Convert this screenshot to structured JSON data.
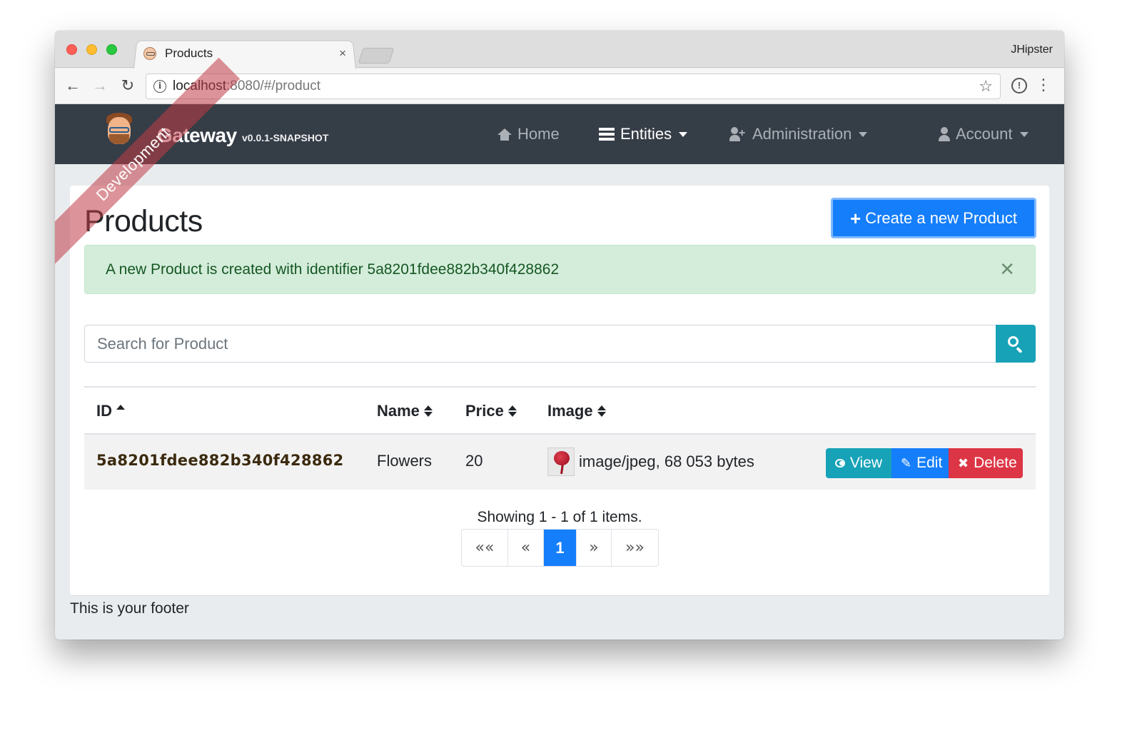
{
  "browser": {
    "tab_title": "Products",
    "tab_close": "×",
    "profile_name": "JHipster",
    "url_host": "localhost",
    "url_rest": ":8080/#/product",
    "back": "←",
    "forward": "→",
    "reload": "↻",
    "star": "☆",
    "ext": "!",
    "menu": "⋮",
    "info": "i"
  },
  "navbar": {
    "brand": "Gateway",
    "version": "v0.0.1-SNAPSHOT",
    "ribbon": "Development",
    "items": [
      {
        "label": "Home",
        "icon": "home-icon",
        "has_caret": false,
        "active": false
      },
      {
        "label": "Entities",
        "icon": "list-icon",
        "has_caret": true,
        "active": true
      },
      {
        "label": "Administration",
        "icon": "user-plus-icon",
        "has_caret": true,
        "active": false
      },
      {
        "label": "Account",
        "icon": "user-icon",
        "has_caret": true,
        "active": false
      }
    ]
  },
  "page": {
    "title": "Products",
    "create_button": "Create a new Product",
    "create_icon": "+",
    "alert": {
      "message": "A new Product is created with identifier 5a8201fdee882b340f428862",
      "close": "✕"
    },
    "search": {
      "placeholder": "Search for Product"
    }
  },
  "table": {
    "columns": [
      "ID",
      "Name",
      "Price",
      "Image"
    ],
    "rows": [
      {
        "id": "5a8201fdee882b340f428862",
        "name": "Flowers",
        "price": "20",
        "image": "image/jpeg, 68 053 bytes",
        "actions": {
          "view": "View",
          "edit": "Edit",
          "delete": "Delete",
          "edit_icon": "✎",
          "delete_icon": "✖"
        }
      }
    ]
  },
  "pagination": {
    "summary": "Showing 1 - 1 of 1 items.",
    "first": "««",
    "prev": "«",
    "current": "1",
    "next": "»",
    "last": "»»"
  },
  "footer": {
    "text": "This is your footer"
  },
  "colors": {
    "navbar": "#353d47",
    "primary": "#157efb",
    "info": "#17a2b8",
    "danger": "#dc3545",
    "success_bg": "#d4edda"
  }
}
